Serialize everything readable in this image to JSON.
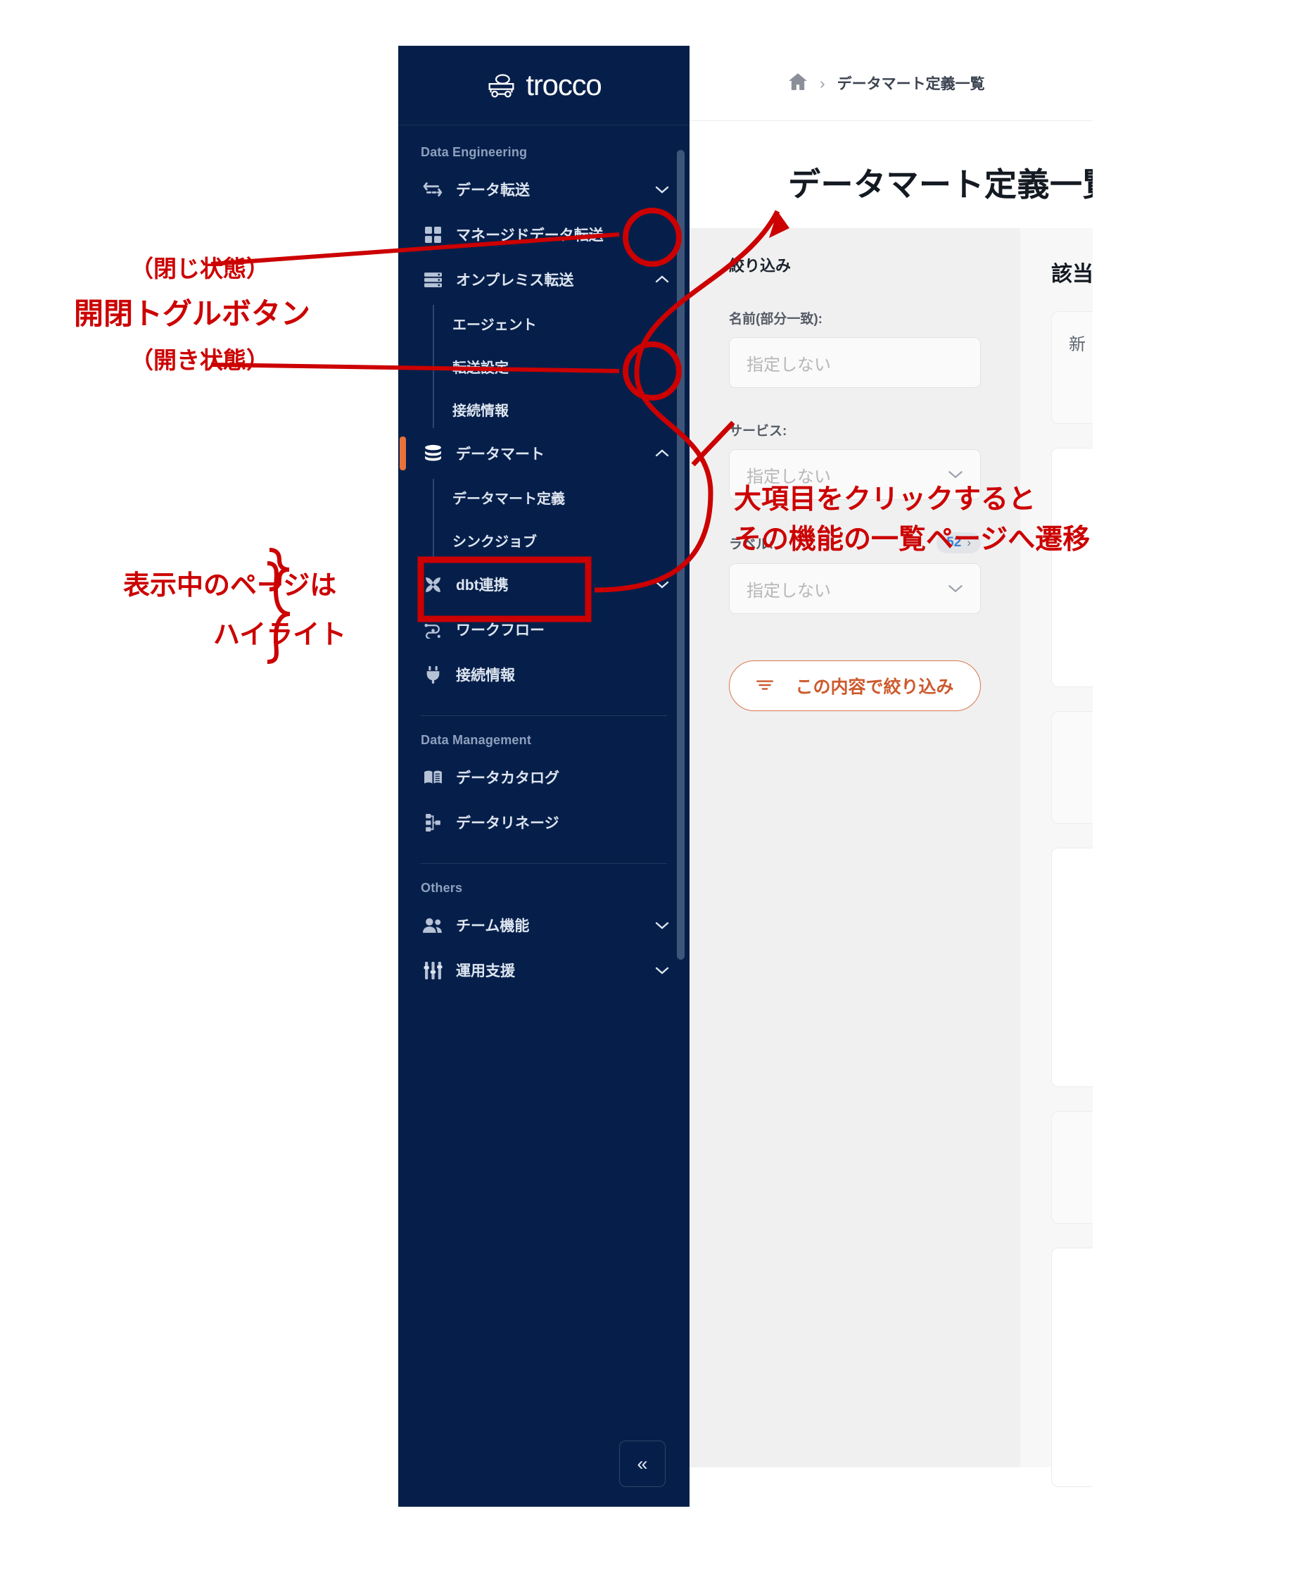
{
  "app": {
    "logo_text": "trocco",
    "logo_icon": "trocco-cart-logo-icon"
  },
  "sidebar": {
    "sections": [
      {
        "title": "Data Engineering",
        "items": [
          {
            "label": "データ転送",
            "icon": "data-transfer-icon",
            "chevron": "chevron-down",
            "active": false,
            "children": []
          },
          {
            "label": "マネージドデータ転送",
            "icon": "managed-transfer-grid-icon",
            "chevron": "",
            "active": false,
            "children": []
          },
          {
            "label": "オンプレミス転送",
            "icon": "onpremise-server-icon",
            "chevron": "chevron-up",
            "active": false,
            "children": [
              "エージェント",
              "転送設定",
              "接続情報"
            ]
          },
          {
            "label": "データマート",
            "icon": "datamart-database-icon",
            "chevron": "chevron-up",
            "active": true,
            "children": [
              "データマート定義",
              "シンクジョブ"
            ]
          },
          {
            "label": "dbt連携",
            "icon": "dbt-icon",
            "chevron": "chevron-down",
            "active": false,
            "children": []
          },
          {
            "label": "ワークフロー",
            "icon": "workflow-icon",
            "chevron": "",
            "active": false,
            "children": []
          },
          {
            "label": "接続情報",
            "icon": "plug-connection-icon",
            "chevron": "",
            "active": false,
            "children": []
          }
        ]
      },
      {
        "title": "Data Management",
        "items": [
          {
            "label": "データカタログ",
            "icon": "book-catalog-icon",
            "chevron": "",
            "active": false,
            "children": []
          },
          {
            "label": "データリネージ",
            "icon": "lineage-tree-icon",
            "chevron": "",
            "active": false,
            "children": []
          }
        ]
      },
      {
        "title": "Others",
        "items": [
          {
            "label": "チーム機能",
            "icon": "team-people-icon",
            "chevron": "chevron-down",
            "active": false,
            "children": []
          },
          {
            "label": "運用支援",
            "icon": "sliders-ops-icon",
            "chevron": "chevron-down",
            "active": false,
            "children": []
          }
        ]
      }
    ],
    "collapse_button": {
      "icon": "double-chevron-left-icon",
      "glyph": "«"
    }
  },
  "breadcrumb": {
    "home_icon": "home-icon",
    "separator": "›",
    "current": "データマート定義一覧"
  },
  "page": {
    "title": "データマート定義一覧"
  },
  "filter": {
    "heading": "絞り込み",
    "fields": [
      {
        "label": "名前(部分一致):",
        "placeholder": "指定しない",
        "type": "text",
        "badge": null
      },
      {
        "label": "サービス:",
        "placeholder": "指定しない",
        "type": "select",
        "badge": null
      },
      {
        "label": "ラベル:",
        "placeholder": "指定しない",
        "type": "select",
        "badge": "52"
      }
    ],
    "badge_arrow": "›",
    "submit_label": "この内容で絞り込み",
    "submit_icon": "filter-icon"
  },
  "results": {
    "heading": "該当",
    "first_card_text": "新"
  },
  "annotations": [
    {
      "id": "toggle-closed-state",
      "text": "（閉じ状態）"
    },
    {
      "id": "toggle-button-title",
      "text": "開閉トグルボタン"
    },
    {
      "id": "toggle-open-state",
      "text": "（開き状態）"
    },
    {
      "id": "active-page-highlight-l1",
      "text": "表示中のページは"
    },
    {
      "id": "active-page-highlight-l2",
      "text": "ハイライト"
    },
    {
      "id": "click-parent-l1",
      "text": "大項目をクリックすると"
    },
    {
      "id": "click-parent-l2",
      "text": "その機能の一覧ページへ遷移"
    }
  ],
  "colors": {
    "sidebar_bg": "#061f4a",
    "accent_orange": "#e8723c",
    "annotation_red": "#cc0000",
    "filter_panel_bg": "#f0f0f0",
    "badge_blue": "#3f7fd0"
  }
}
